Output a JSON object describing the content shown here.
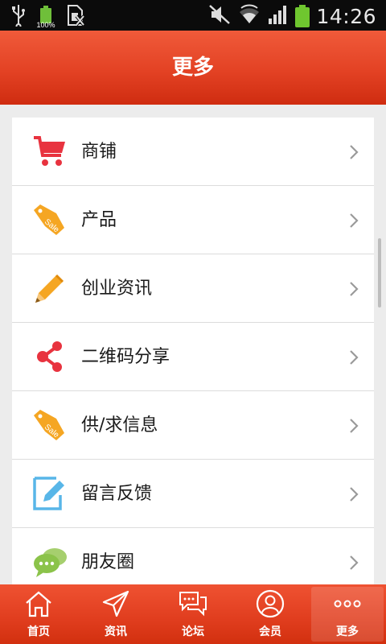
{
  "status_bar": {
    "battery_small_label": "100%",
    "time": "14:26"
  },
  "header": {
    "title": "更多"
  },
  "menu": [
    {
      "label": "商铺",
      "icon": "cart-icon"
    },
    {
      "label": "产品",
      "icon": "sale-tag-icon"
    },
    {
      "label": "创业资讯",
      "icon": "pencil-icon"
    },
    {
      "label": "二维码分享",
      "icon": "share-icon"
    },
    {
      "label": "供/求信息",
      "icon": "sale-tag-icon"
    },
    {
      "label": "留言反馈",
      "icon": "edit-note-icon"
    },
    {
      "label": "朋友圈",
      "icon": "chat-bubbles-icon"
    }
  ],
  "nav": [
    {
      "label": "首页",
      "icon": "home-icon"
    },
    {
      "label": "资讯",
      "icon": "send-icon"
    },
    {
      "label": "论坛",
      "icon": "forum-icon"
    },
    {
      "label": "会员",
      "icon": "member-icon"
    },
    {
      "label": "更多",
      "icon": "more-icon"
    }
  ],
  "colors": {
    "header_red": "#e34224",
    "cart_red": "#e8333f",
    "tag_orange": "#f5a623",
    "pencil_orange": "#f5a623",
    "share_red": "#e8333f",
    "note_blue": "#58b6e8",
    "chat_green": "#8bc34a"
  }
}
